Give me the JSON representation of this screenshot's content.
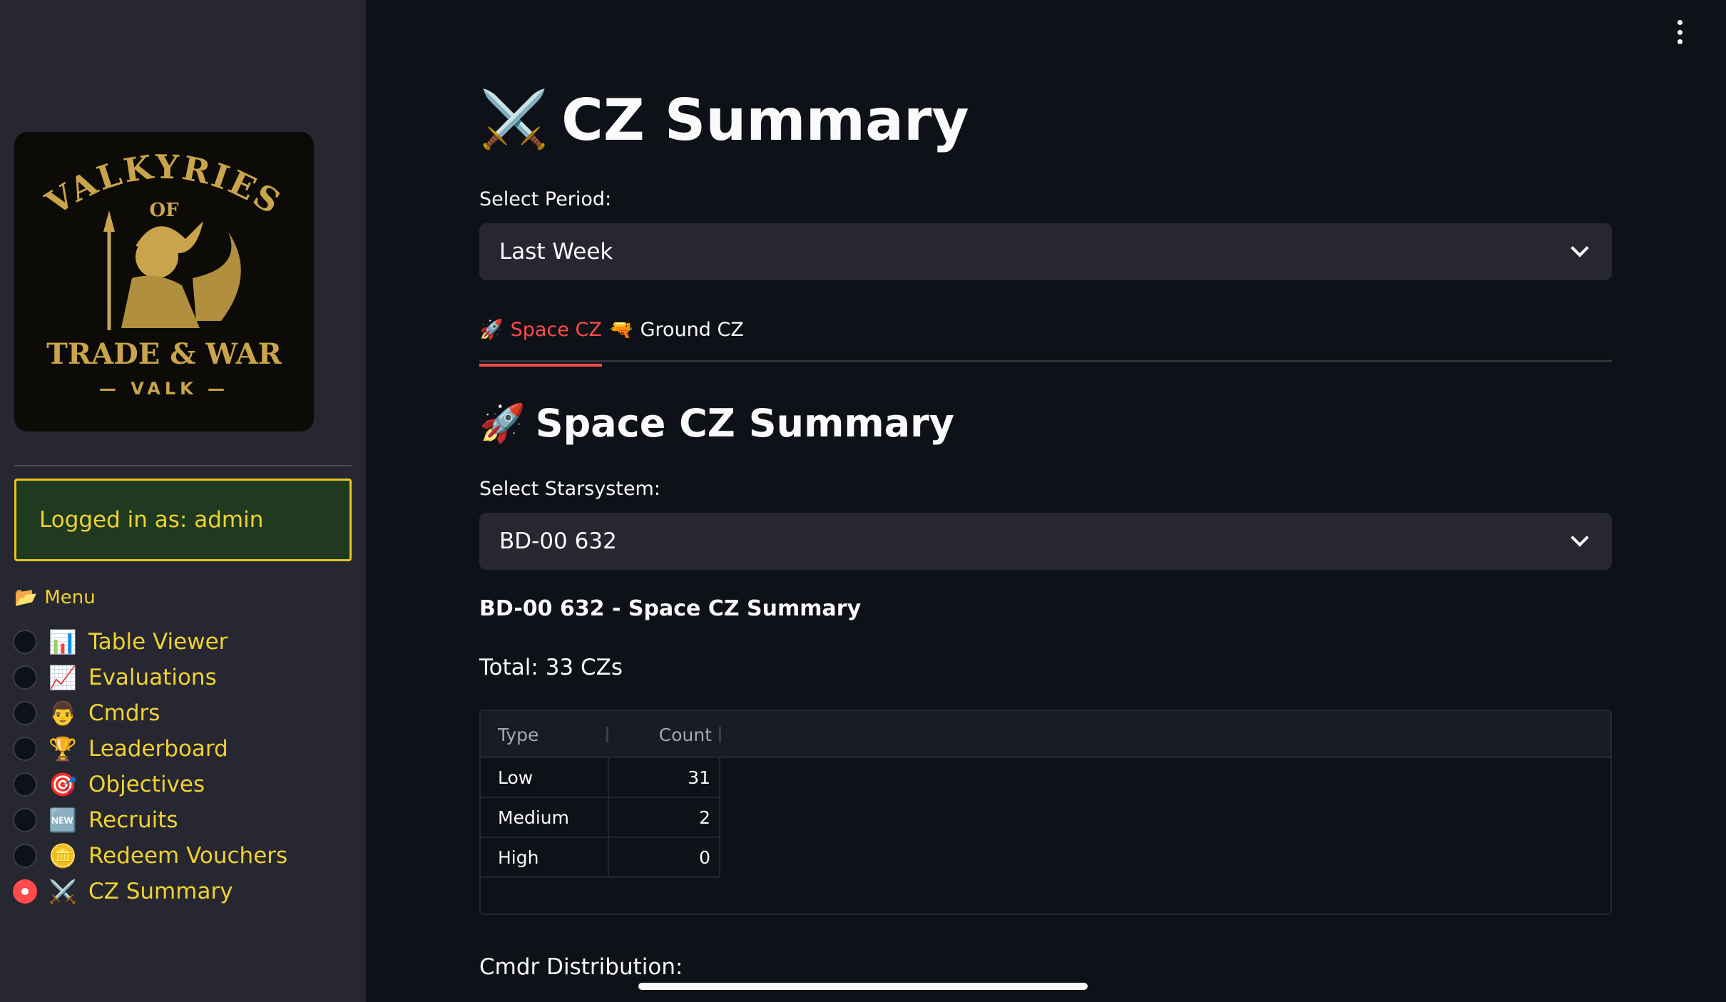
{
  "sidebar": {
    "logo": {
      "top": "VALKYRIES",
      "of": "OF",
      "main": "TRADE & WAR",
      "sub": "— VALK —"
    },
    "login_text": "Logged in as: admin",
    "menu_title": "Menu",
    "menu_icon": "📂",
    "items": [
      {
        "icon": "📊",
        "label": "Table Viewer",
        "selected": false
      },
      {
        "icon": "📈",
        "label": "Evaluations",
        "selected": false
      },
      {
        "icon": "👨",
        "label": "Cmdrs",
        "selected": false
      },
      {
        "icon": "🏆",
        "label": "Leaderboard",
        "selected": false
      },
      {
        "icon": "🎯",
        "label": "Objectives",
        "selected": false
      },
      {
        "icon": "🆕",
        "label": "Recruits",
        "selected": false
      },
      {
        "icon": "🪙",
        "label": "Redeem Vouchers",
        "selected": false
      },
      {
        "icon": "⚔️",
        "label": "CZ Summary",
        "selected": true
      }
    ]
  },
  "main": {
    "title_icon": "⚔️",
    "title": "CZ Summary",
    "period_label": "Select Period:",
    "period_value": "Last Week",
    "tabs": [
      {
        "icon": "🚀",
        "label": "Space CZ",
        "active": true
      },
      {
        "icon": "🔫",
        "label": "Ground CZ",
        "active": false
      }
    ],
    "section_icon": "🚀",
    "section_title": "Space CZ Summary",
    "starsystem_label": "Select Starsystem:",
    "starsystem_value": "BD-00 632",
    "subheading": "BD-00 632 - Space CZ Summary",
    "total": "Total: 33 CZs",
    "table": {
      "columns": [
        "Type",
        "Count"
      ],
      "rows": [
        [
          "Low",
          "31"
        ],
        [
          "Medium",
          "2"
        ],
        [
          "High",
          "0"
        ]
      ]
    },
    "cmdr_distribution_label": "Cmdr Distribution:"
  },
  "colors": {
    "accent": "#ff4b4b",
    "sidebar_text": "#f0d230",
    "login_bg": "#1f3a1f",
    "login_border": "#e6c41f"
  }
}
